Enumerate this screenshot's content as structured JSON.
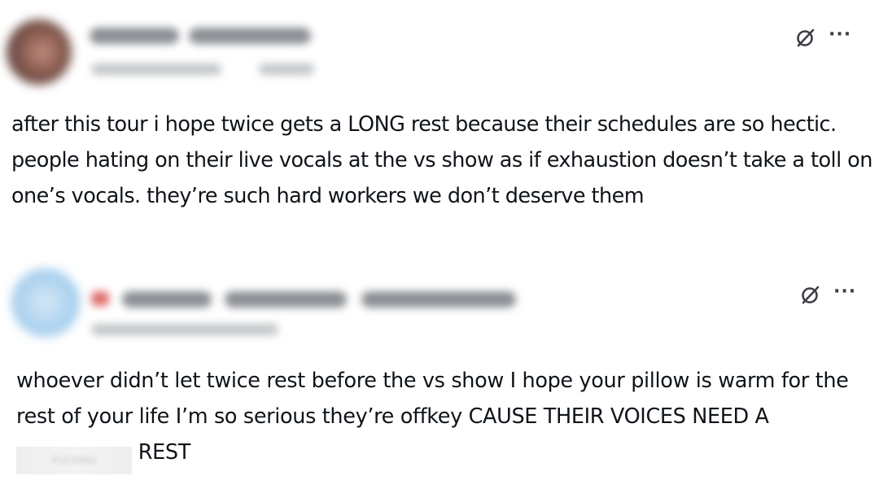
{
  "posts": [
    {
      "text": "after this tour i hope twice gets a LONG rest because their schedules are so hectic. people hating on their live vocals at the vs show as if exhaustion doesn’t take a toll on one’s vocals. they’re such hard workers we don’t deserve them",
      "icons": {
        "grok": "grok-icon",
        "more": "more-options-icon"
      }
    },
    {
      "text_before": "whoever didn’t let twice rest before the vs show I hope your pillow is warm for the rest of your life I’m so serious they’re offkey CAUSE THEIR VOICES NEED A ",
      "censored_word": "FUCKING",
      "text_after": " REST",
      "icons": {
        "grok": "grok-icon",
        "more": "more-options-icon"
      }
    }
  ],
  "ui": {
    "more_glyph": "···"
  }
}
